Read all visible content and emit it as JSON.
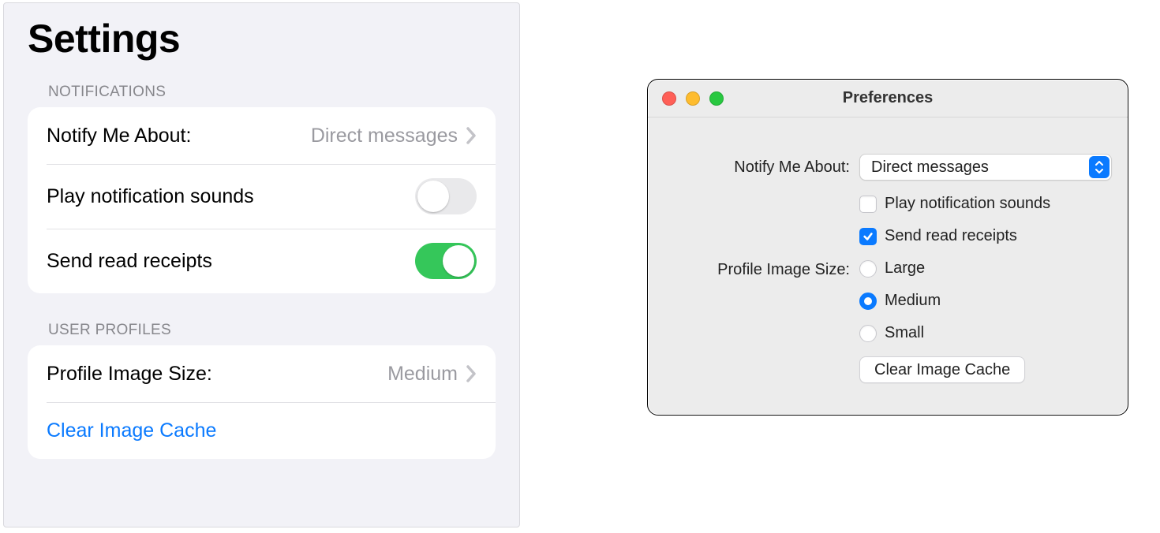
{
  "ios": {
    "title": "Settings",
    "sections": {
      "notifications": {
        "header": "NOTIFICATIONS",
        "notify_label": "Notify Me About:",
        "notify_value": "Direct messages",
        "play_sounds_label": "Play notification sounds",
        "play_sounds_on": false,
        "read_receipts_label": "Send read receipts",
        "read_receipts_on": true
      },
      "user_profiles": {
        "header": "USER PROFILES",
        "image_size_label": "Profile Image Size:",
        "image_size_value": "Medium",
        "clear_cache_label": "Clear Image Cache"
      }
    }
  },
  "mac": {
    "title": "Preferences",
    "notify_label": "Notify Me About:",
    "notify_value": "Direct messages",
    "play_sounds_label": "Play notification sounds",
    "play_sounds_checked": false,
    "read_receipts_label": "Send read receipts",
    "read_receipts_checked": true,
    "image_size_label": "Profile Image Size:",
    "image_size_options": [
      "Large",
      "Medium",
      "Small"
    ],
    "image_size_selected": "Medium",
    "clear_cache_label": "Clear Image Cache"
  }
}
